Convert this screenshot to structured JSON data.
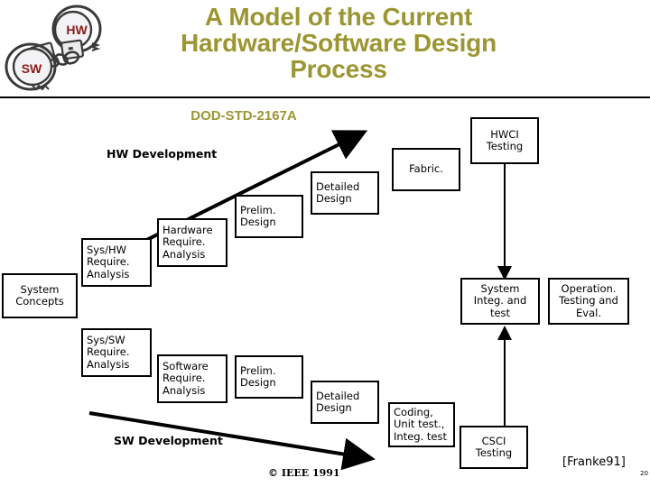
{
  "slide": {
    "title": "A Model of the Current Hardware/Software Design Process",
    "title_lines": [
      "A Model of the Current",
      "Hardware/Software Design",
      "Process"
    ],
    "subtitle": "DOD-STD-2167A",
    "title_color": "#9b9632",
    "credit": "© IEEE 1991",
    "citation": "[Franke91]",
    "page_number": "20"
  },
  "logo": {
    "name": "handcuffs-graphic",
    "left_cuff_label": "SW",
    "right_cuff_label": "HW",
    "label_color": "#8b1a1a"
  },
  "labels": {
    "hw_development": "HW Development",
    "sw_development": "SW Development"
  },
  "hw_track": [
    {
      "id": "sys-hw-require-analysis",
      "text": "Sys/HW Require. Analysis",
      "lines": [
        "Sys/HW",
        "Require.",
        "Analysis"
      ]
    },
    {
      "id": "hardware-require-analysis",
      "text": "Hardware Require. Analysis",
      "lines": [
        "Hardware",
        "Require.",
        "Analysis"
      ]
    },
    {
      "id": "hw-prelim-design",
      "text": "Prelim. Design",
      "lines": [
        "Prelim.",
        "Design"
      ]
    },
    {
      "id": "hw-detailed-design",
      "text": "Detailed Design",
      "lines": [
        "Detailed",
        "Design"
      ]
    },
    {
      "id": "fabrication",
      "text": "Fabric.",
      "lines": [
        "Fabric."
      ]
    },
    {
      "id": "hwci-testing",
      "text": "HWCI Testing",
      "lines": [
        "HWCI",
        "Testing"
      ]
    }
  ],
  "sw_track": [
    {
      "id": "sys-sw-require-analysis",
      "text": "Sys/SW Require. Analysis",
      "lines": [
        "Sys/SW",
        "Require.",
        "Analysis"
      ]
    },
    {
      "id": "software-require-analysis",
      "text": "Software Require. Analysis",
      "lines": [
        "Software",
        "Require.",
        "Analysis"
      ]
    },
    {
      "id": "sw-prelim-design",
      "text": "Prelim. Design",
      "lines": [
        "Prelim.",
        "Design"
      ]
    },
    {
      "id": "sw-detailed-design",
      "text": "Detailed Design",
      "lines": [
        "Detailed",
        "Design"
      ]
    },
    {
      "id": "coding-unit-test",
      "text": "Coding, Unit test., Integ. test",
      "lines": [
        "Coding,",
        "Unit test.,",
        "Integ. test"
      ]
    },
    {
      "id": "csci-testing",
      "text": "CSCI Testing",
      "lines": [
        "CSCI",
        "Testing"
      ]
    }
  ],
  "common": {
    "system_concepts": {
      "text": "System Concepts",
      "lines": [
        "System",
        "Concepts"
      ]
    },
    "system_integ_test": {
      "text": "System Integ. and test",
      "lines": [
        "System",
        "Integ. and",
        "test"
      ]
    },
    "operation_testing_eval": {
      "text": "Operation. Testing and Eval.",
      "lines": [
        "Operation.",
        "Testing and",
        "Eval."
      ]
    }
  }
}
